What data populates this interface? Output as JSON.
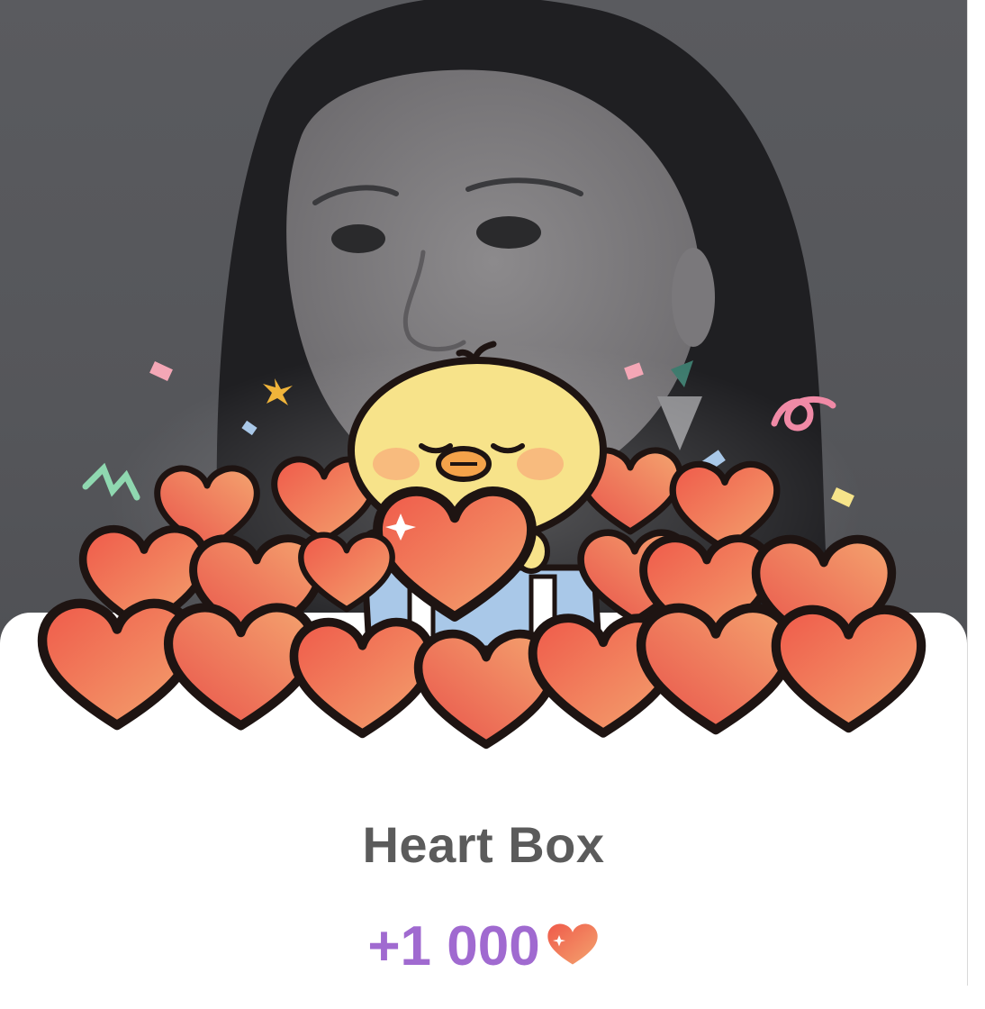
{
  "dialog": {
    "title": "Heart Box",
    "reward_amount": "+1 000",
    "reward_icon": "heart-icon"
  },
  "colors": {
    "title": "#5b5b5b",
    "reward": "#a06ad0",
    "heart_light": "#f5a86e",
    "heart_dark": "#e9524a",
    "chick": "#f7e38a",
    "box": "#a9c8e8"
  },
  "background": {
    "content": "dimmed profile photo"
  }
}
